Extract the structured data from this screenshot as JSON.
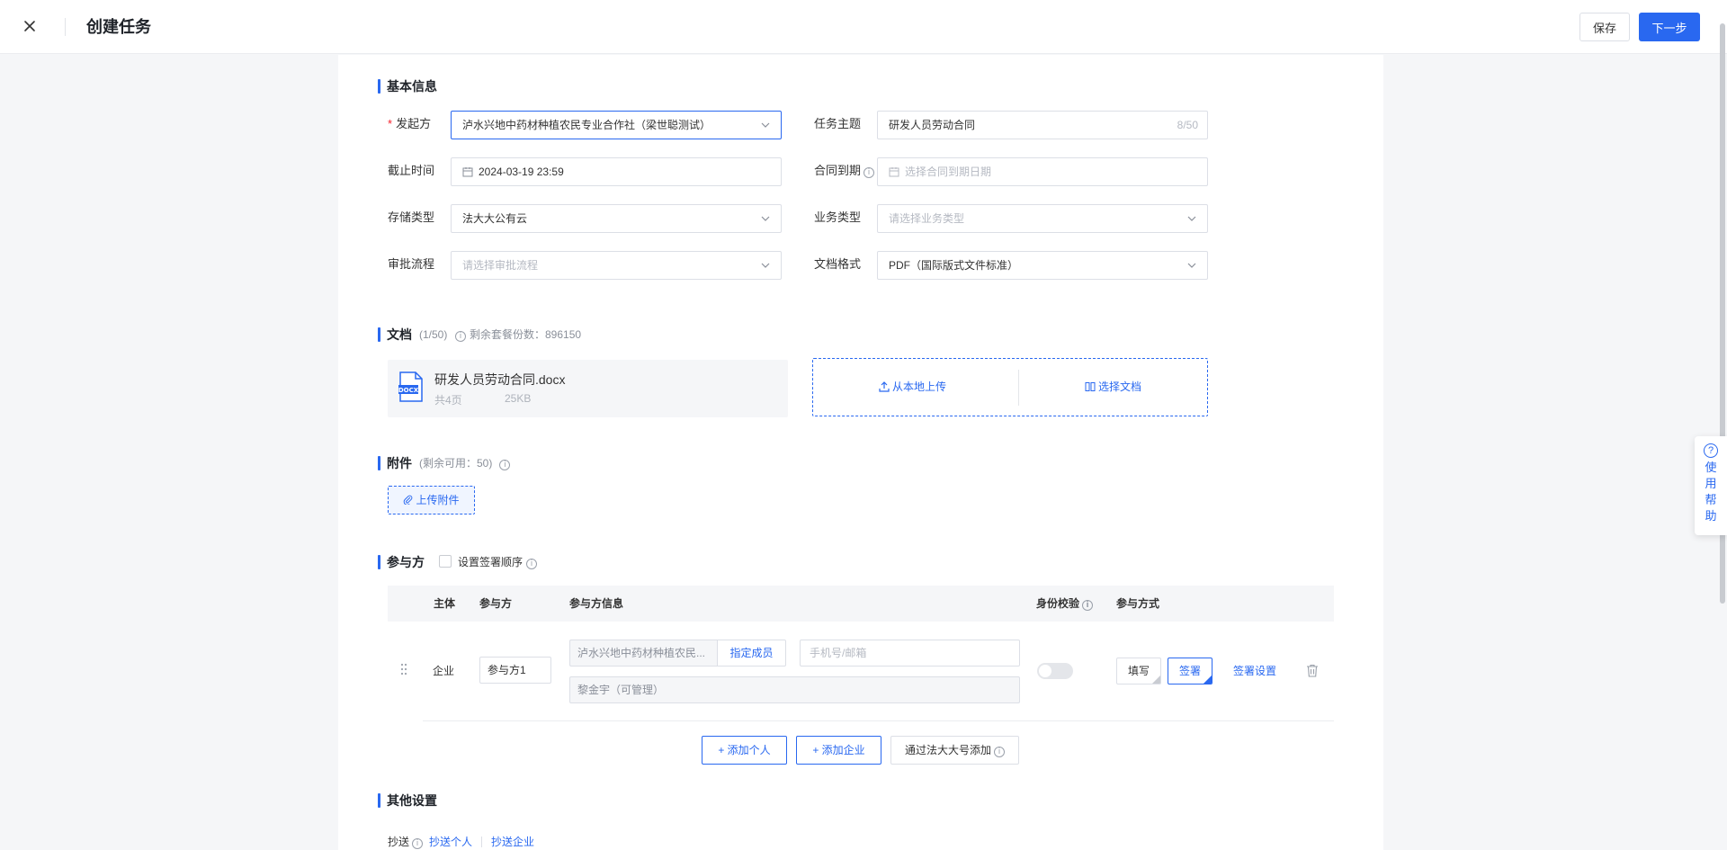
{
  "header": {
    "title": "创建任务",
    "save_label": "保存",
    "next_label": "下一步"
  },
  "basic": {
    "section_title": "基本信息",
    "initiator_label": "发起方",
    "initiator_required": "*",
    "initiator_value": "泸水兴地中药材种植农民专业合作社（梁世聪测试）",
    "subject_label": "任务主题",
    "subject_value": "研发人员劳动合同",
    "subject_count": "8/50",
    "deadline_label": "截止时间",
    "deadline_value": "2024-03-19 23:59",
    "contract_expiry_label": "合同到期",
    "contract_expiry_placeholder": "选择合同到期日期",
    "storage_label": "存储类型",
    "storage_value": "法大大公有云",
    "business_label": "业务类型",
    "business_placeholder": "请选择业务类型",
    "approval_label": "审批流程",
    "approval_placeholder": "请选择审批流程",
    "format_label": "文档格式",
    "format_value": "PDF（国际版式文件标准）"
  },
  "documents": {
    "section_title": "文档",
    "count": "(1/50)",
    "remaining": "剩余套餐份数：896150",
    "file_name": "研发人员劳动合同.docx",
    "file_type": "DOCX",
    "pages": "共4页",
    "size": "25KB",
    "upload_local": "从本地上传",
    "choose_doc": "选择文档"
  },
  "attachments": {
    "section_title": "附件",
    "remaining": "(剩余可用：50)",
    "upload_label": "上传附件"
  },
  "participants": {
    "section_title": "参与方",
    "order_label": "设置签署顺序",
    "columns": {
      "subject": "主体",
      "party": "参与方",
      "party_info": "参与方信息",
      "identity": "身份校验",
      "mode": "参与方式"
    },
    "row": {
      "subject": "企业",
      "party": "参与方1",
      "org": "泸水兴地中药材种植农民...",
      "assign": "指定成员",
      "phone_placeholder": "手机号/邮箱",
      "member": "黎金宇（可管理）",
      "fill": "填写",
      "sign": "签署",
      "sign_settings": "签署设置"
    },
    "add_person": "+ 添加个人",
    "add_company": "+ 添加企业",
    "add_by_number": "通过法大大号添加"
  },
  "other": {
    "section_title": "其他设置",
    "cc_label": "抄送",
    "cc_person": "抄送个人",
    "cc_company": "抄送企业"
  },
  "help": {
    "label": "使用帮助"
  },
  "colors": {
    "primary": "#2968f0",
    "required": "#f5222d"
  }
}
